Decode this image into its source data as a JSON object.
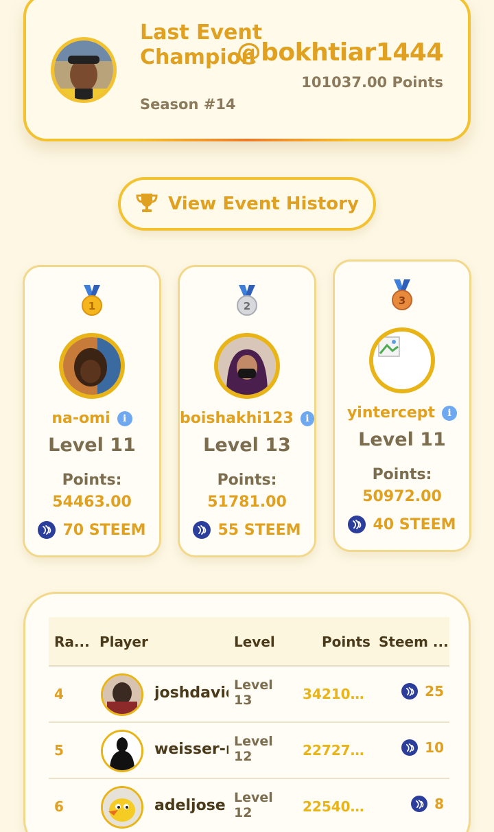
{
  "champion": {
    "title": "Last Event Champion",
    "season": "Season #14",
    "handle": "@bokhtiar1444",
    "points": "101037.00 Points"
  },
  "history_button": {
    "label": "View Event History"
  },
  "podium": [
    {
      "rank": "1",
      "name": "na-omi",
      "level": "Level 11",
      "points_label": "Points:",
      "points": "54463.00",
      "reward": "70 STEEM"
    },
    {
      "rank": "2",
      "name": "boishakhi123",
      "level": "Level 13",
      "points_label": "Points:",
      "points": "51781.00",
      "reward": "55 STEEM"
    },
    {
      "rank": "3",
      "name": "yintercept",
      "level": "Level 11",
      "points_label": "Points:",
      "points": "50972.00",
      "reward": "40 STEEM"
    }
  ],
  "table": {
    "headers": {
      "rank": "Ra...",
      "player": "Player",
      "level": "Level",
      "points": "Points",
      "steem": "Steem ..."
    },
    "rows": [
      {
        "rank": "4",
        "player": "joshdavid",
        "level": "Level 13",
        "points": "34210....",
        "reward": "25"
      },
      {
        "rank": "5",
        "player": "weisser-r",
        "level": "Level 12",
        "points": "22727....",
        "reward": "10"
      },
      {
        "rank": "6",
        "player": "adeljose",
        "level": "Level 12",
        "points": "22540....",
        "reward": "8"
      }
    ]
  },
  "colors": {
    "accent": "#e0a020",
    "border": "#f2c230",
    "background": "#fdf7e4",
    "steem_blue": "#2c3e9c"
  }
}
